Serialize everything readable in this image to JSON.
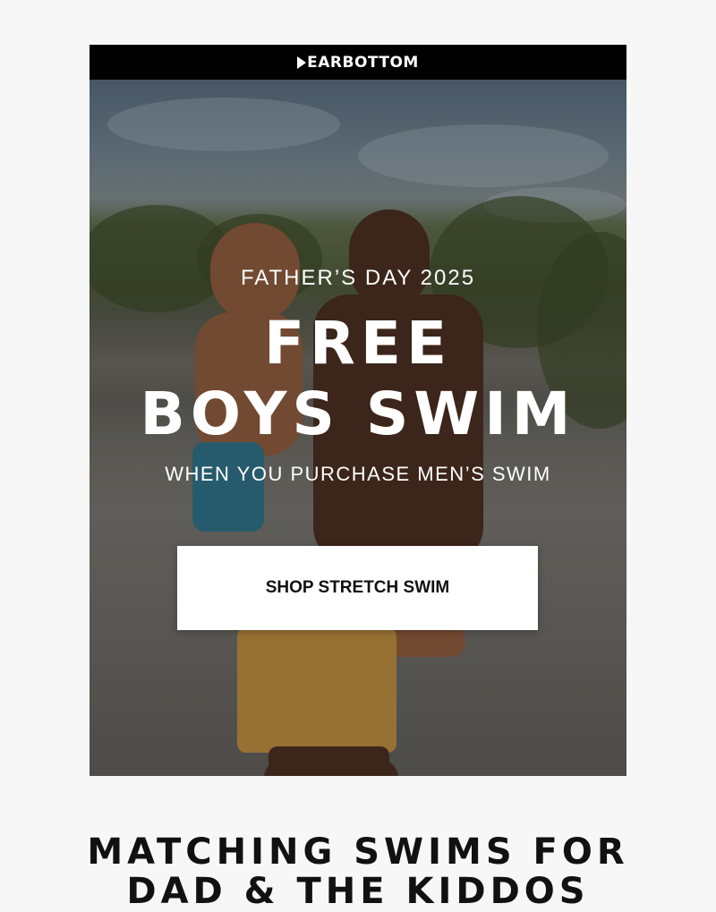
{
  "brand": {
    "name": "EARBOTTOM",
    "logo_icon": "bear-chevron-icon"
  },
  "hero": {
    "eyebrow": "FATHER’S DAY 2025",
    "headline_line1": "FREE",
    "headline_line2": "BOYS SWIM",
    "subline": "WHEN YOU PURCHASE MEN’S SWIM",
    "cta_label": "SHOP STRETCH SWIM"
  },
  "section": {
    "title_line1": "MATCHING SWIMS FOR",
    "title_line2": "DAD & THE KIDDOS"
  },
  "colors": {
    "bar": "#000000",
    "page_bg": "#f7f7f7",
    "cta_bg": "#ffffff",
    "cta_text": "#111111"
  }
}
